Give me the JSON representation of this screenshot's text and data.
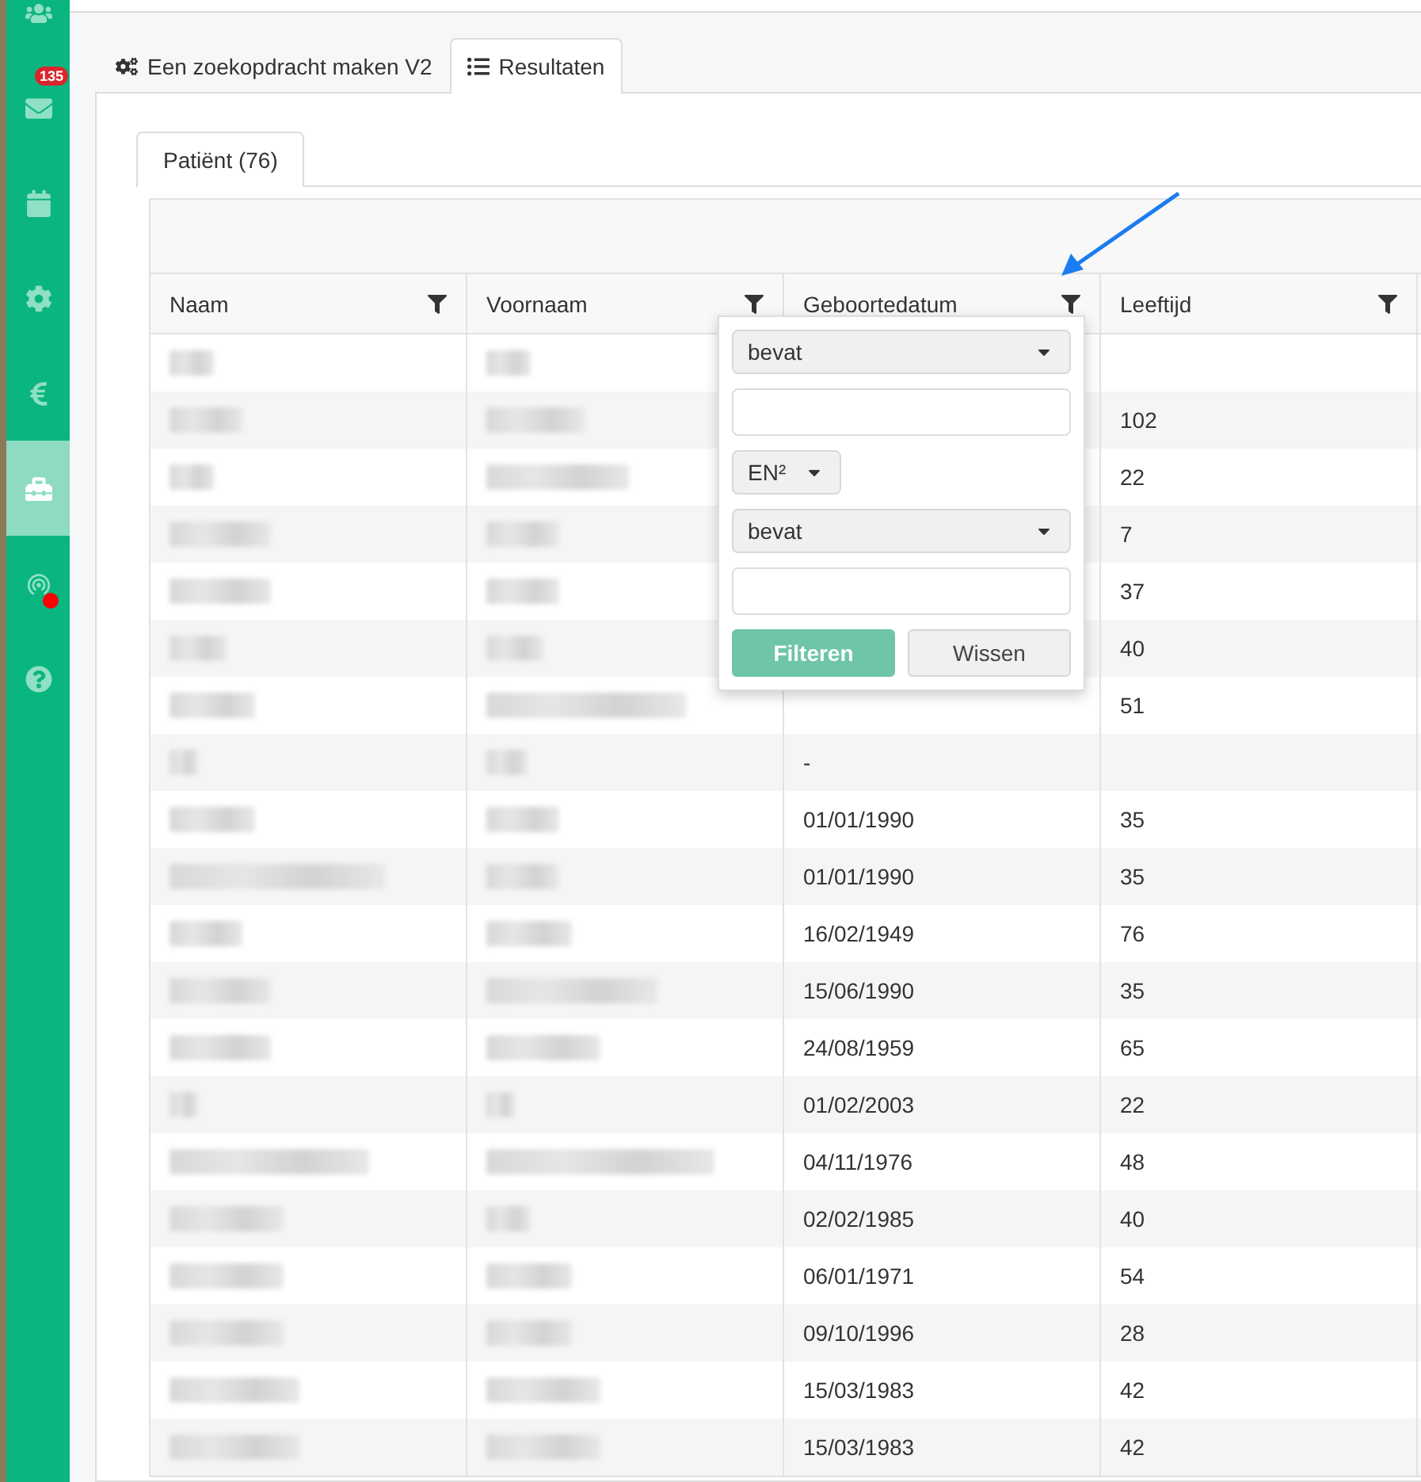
{
  "sidebar": {
    "items": [
      {
        "kind": "users",
        "selected": false
      },
      {
        "kind": "mail",
        "selected": false,
        "badge": "135"
      },
      {
        "kind": "calendar",
        "selected": false
      },
      {
        "kind": "gear",
        "selected": false
      },
      {
        "kind": "euro",
        "selected": false
      },
      {
        "kind": "briefcase",
        "selected": true
      },
      {
        "kind": "signal",
        "selected": false,
        "dot": true
      },
      {
        "kind": "help",
        "selected": false
      }
    ]
  },
  "tabs": [
    {
      "label": "Een zoekopdracht maken V2",
      "kind": "gears",
      "selected": false
    },
    {
      "label": "Resultaten",
      "kind": "list",
      "selected": true
    }
  ],
  "inner_tabs": [
    {
      "label": "Patiënt (76)",
      "selected": true
    }
  ],
  "table": {
    "columns": [
      "Naam",
      "Voornaam",
      "Geboortedatum",
      "Leeftijd"
    ],
    "rows": [
      {
        "age": ""
      },
      {
        "age": "102"
      },
      {
        "age": "22"
      },
      {
        "age": "7"
      },
      {
        "age": "37"
      },
      {
        "age": "40"
      },
      {
        "age": "51"
      },
      {
        "birth_date": "-",
        "age": ""
      },
      {
        "birth_date": "01/01/1990",
        "age": "35"
      },
      {
        "birth_date": "01/01/1990",
        "age": "35"
      },
      {
        "birth_date": "16/02/1949",
        "age": "76"
      },
      {
        "birth_date": "15/06/1990",
        "age": "35"
      },
      {
        "birth_date": "24/08/1959",
        "age": "65"
      },
      {
        "birth_date": "01/02/2003",
        "age": "22"
      },
      {
        "birth_date": "04/11/1976",
        "age": "48"
      },
      {
        "birth_date": "02/02/1985",
        "age": "40"
      },
      {
        "birth_date": "06/01/1971",
        "age": "54"
      },
      {
        "birth_date": "09/10/1996",
        "age": "28"
      },
      {
        "birth_date": "15/03/1983",
        "age": "42"
      },
      {
        "birth_date": "15/03/1983",
        "age": "42"
      }
    ]
  },
  "filter_popup": {
    "condition_1": "bevat",
    "operator": "EN²",
    "condition_2": "bevat",
    "buttons": [
      {
        "label": "Filteren",
        "kind": "primary"
      },
      {
        "label": "Wissen",
        "kind": "secondary"
      }
    ]
  }
}
